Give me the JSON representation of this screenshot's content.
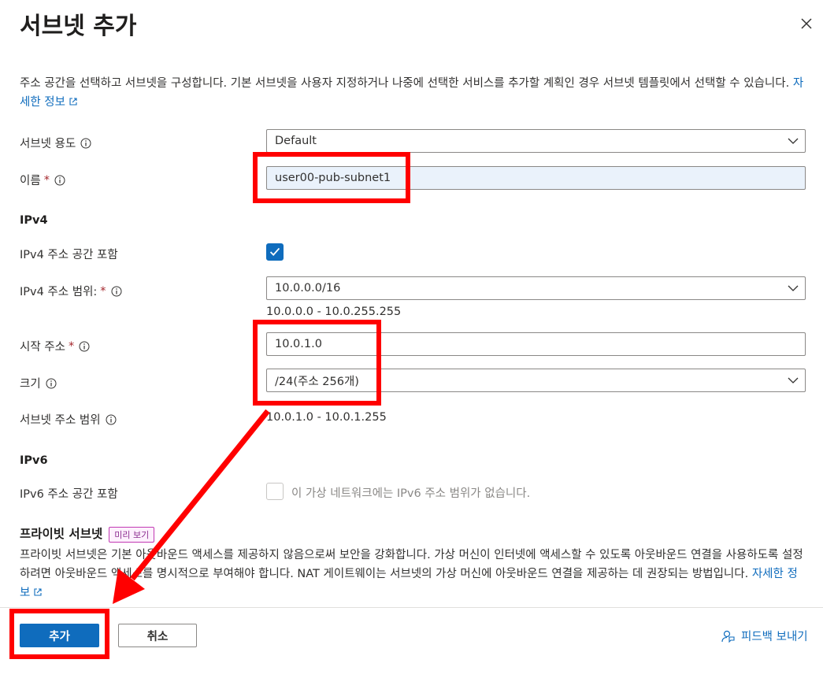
{
  "header": {
    "title": "서브넷 추가"
  },
  "description": {
    "text": "주소 공간을 선택하고 서브넷을 구성합니다. 기본 서브넷을 사용자 지정하거나 나중에 선택한 서비스를 추가할 계획인 경우 서브넷 템플릿에서 선택할 수 있습니다.",
    "link": "자세한 정보"
  },
  "form": {
    "purpose": {
      "label": "서브넷 용도",
      "value": "Default"
    },
    "name": {
      "label": "이름",
      "required": "*",
      "value": "user00-pub-subnet1"
    },
    "ipv4": {
      "section": "IPv4",
      "include_label": "IPv4 주소 공간 포함",
      "include_checked": true,
      "range_label": "IPv4 주소 범위:",
      "range_required": "*",
      "range_value": "10.0.0.0/16",
      "range_hint": "10.0.0.0 - 10.0.255.255",
      "start_label": "시작 주소",
      "start_required": "*",
      "start_value": "10.0.1.0",
      "size_label": "크기",
      "size_value": "/24(주소 256개)",
      "subnet_range_label": "서브넷 주소 범위",
      "subnet_range_value": "10.0.1.0 - 10.0.1.255"
    },
    "ipv6": {
      "section": "IPv6",
      "include_label": "IPv6 주소 공간 포함",
      "include_checked": false,
      "disabled_text": "이 가상 네트워크에는 IPv6 주소 범위가 없습니다."
    },
    "private": {
      "title": "프라이빗 서브넷",
      "badge": "미리 보기",
      "text": "프라이빗 서브넷은 기본 아웃바운드 액세스를 제공하지 않음으로써 보안을 강화합니다. 가상 머신이 인터넷에 액세스할 수 있도록 아웃바운드 연결을 사용하도록 설정하려면 아웃바운드 액세스를 명시적으로 부여해야 합니다. NAT 게이트웨이는 서브넷의 가상 머신에 아웃바운드 연결을 제공하는 데 권장되는 방법입니다.",
      "link": "자세한 정보"
    }
  },
  "footer": {
    "add_label": "추가",
    "cancel_label": "취소",
    "feedback_label": "피드백 보내기"
  },
  "colors": {
    "accent": "#0f6cbd",
    "annotation": "#ff0000"
  }
}
